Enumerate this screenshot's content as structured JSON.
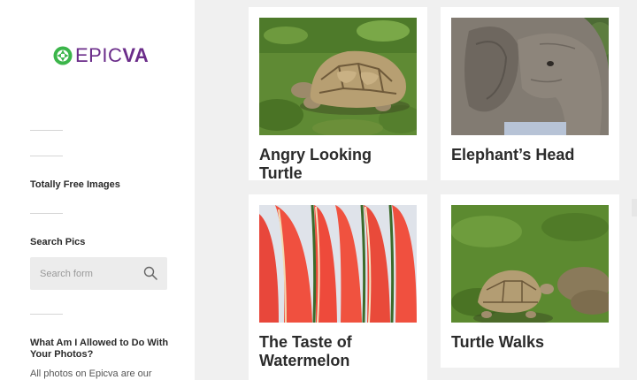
{
  "logo": {
    "part1": "EPIC",
    "part2": "VA"
  },
  "sidebar": {
    "widget1_title": "Totally Free Images",
    "search_title": "Search Pics",
    "search_placeholder": "Search form",
    "widget3_title": "What Am I Allowed to Do With Your Photos?",
    "widget3_text": "All photos on Epicva are our"
  },
  "cards": [
    {
      "title": "Angry Looking Turtle",
      "image": "turtle-photo"
    },
    {
      "title": "Elephant’s Head",
      "image": "elephant-photo"
    },
    {
      "title": "The Taste of Watermelon",
      "image": "watermelon-photo"
    },
    {
      "title": "Turtle Walks",
      "image": "turtle-walking-photo"
    }
  ],
  "colors": {
    "brand_green": "#3bb54a",
    "brand_purple": "#6b2d8a",
    "page_bg": "#f0f0f0"
  }
}
